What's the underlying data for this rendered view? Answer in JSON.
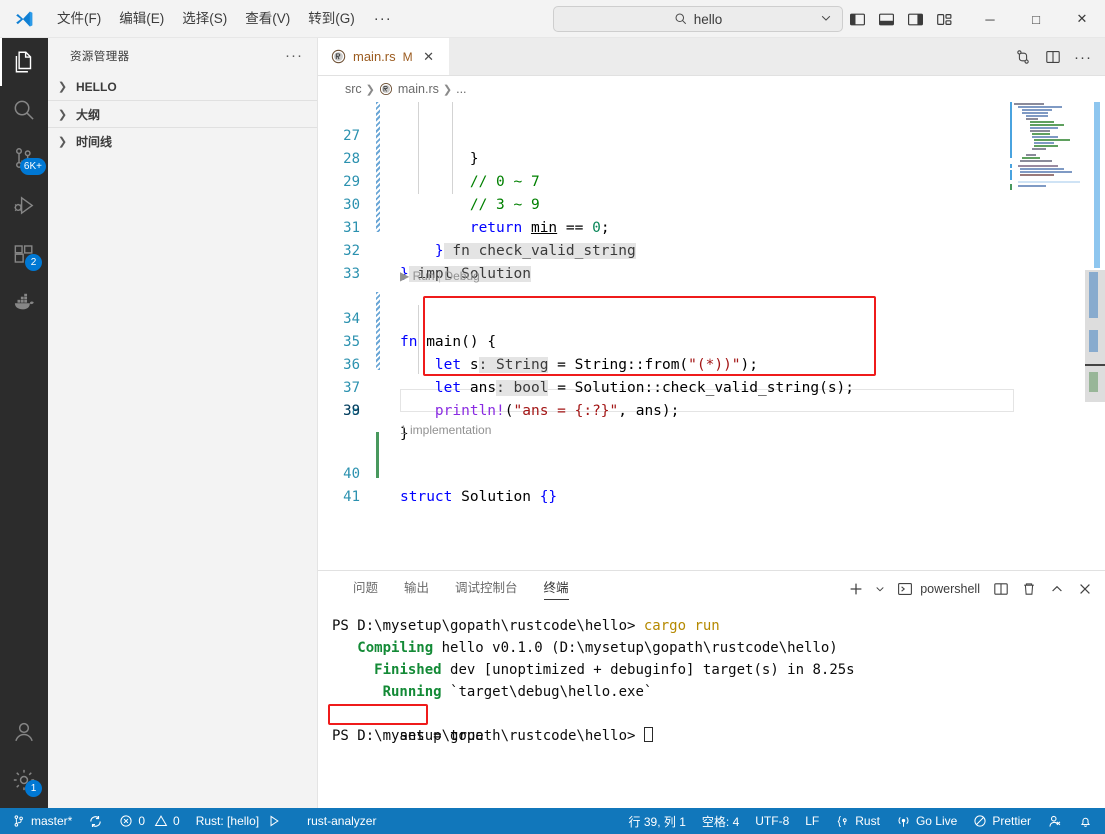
{
  "titlebar": {
    "logo_icon": "vscode-logo-icon",
    "menu": [
      {
        "label": "文件(F)",
        "name": "menu-file"
      },
      {
        "label": "编辑(E)",
        "name": "menu-edit"
      },
      {
        "label": "选择(S)",
        "name": "menu-selection"
      },
      {
        "label": "查看(V)",
        "name": "menu-view"
      },
      {
        "label": "转到(G)",
        "name": "menu-go"
      }
    ],
    "more_label": "···",
    "quick_open": {
      "value": "hello",
      "search_icon": "search-icon",
      "chevron_icon": "chevron-down-icon"
    },
    "layout_icons": [
      {
        "name": "toggle-primary-sidebar-icon"
      },
      {
        "name": "toggle-panel-icon"
      },
      {
        "name": "toggle-secondary-sidebar-icon"
      },
      {
        "name": "customize-layout-icon"
      }
    ],
    "window_controls": {
      "minimize": "─",
      "maximize": "□",
      "close": "✕"
    }
  },
  "activitybar": {
    "items": [
      {
        "name": "activity-explorer",
        "icon": "files-icon",
        "badge": "",
        "active": true
      },
      {
        "name": "activity-search",
        "icon": "search-icon",
        "badge": "",
        "active": false
      },
      {
        "name": "activity-source-control",
        "icon": "source-control-icon",
        "badge": "6K+",
        "active": false
      },
      {
        "name": "activity-run-debug",
        "icon": "run-debug-icon",
        "badge": "",
        "active": false
      },
      {
        "name": "activity-extensions",
        "icon": "extensions-icon",
        "badge": "2",
        "active": false
      },
      {
        "name": "activity-docker",
        "icon": "docker-icon",
        "badge": "",
        "active": false
      }
    ],
    "bottom": [
      {
        "name": "activity-accounts",
        "icon": "account-icon",
        "badge": ""
      },
      {
        "name": "activity-settings",
        "icon": "gear-icon",
        "badge": "1"
      }
    ]
  },
  "sidebar": {
    "title": "资源管理器",
    "more_label": "···",
    "sections": [
      {
        "label": "HELLO",
        "name": "sidebar-section-hello",
        "expanded": false
      },
      {
        "label": "大纲",
        "name": "sidebar-section-outline",
        "expanded": false
      },
      {
        "label": "时间线",
        "name": "sidebar-section-timeline",
        "expanded": false
      }
    ]
  },
  "editor": {
    "tab": {
      "label": "main.rs",
      "modified_indicator": "M",
      "close_icon": "close-icon",
      "file_icon": "rust-icon"
    },
    "tab_actions": [
      {
        "name": "split-compare-icon"
      },
      {
        "name": "split-editor-icon"
      },
      {
        "name": "editor-more-actions-icon"
      }
    ],
    "breadcrumb": [
      "src",
      "main.rs",
      "..."
    ],
    "codelens_run": "Run",
    "codelens_debug": "Debug",
    "codelens_impl": "1 implementation",
    "lines": [
      {
        "num": "27",
        "text": "        }"
      },
      {
        "num": "28",
        "text": "        // 0 ~ 7"
      },
      {
        "num": "29",
        "text": "        // 3 ~ 9"
      },
      {
        "num": "30",
        "text": "        return min == 0;"
      },
      {
        "num": "31",
        "text": "    } fn check_valid_string"
      },
      {
        "num": "32",
        "text": "} impl Solution"
      },
      {
        "num": "33",
        "text": ""
      },
      {
        "num": "34",
        "text": "fn main() {"
      },
      {
        "num": "35",
        "text": "    let s: String = String::from(\"(*))\");"
      },
      {
        "num": "36",
        "text": "    let ans: bool = Solution::check_valid_string(s);"
      },
      {
        "num": "37",
        "text": "    println!(\"ans = {:?}\", ans);"
      },
      {
        "num": "38",
        "text": "}"
      },
      {
        "num": "39",
        "text": ""
      },
      {
        "num": "40",
        "text": "struct Solution {}"
      },
      {
        "num": "41",
        "text": ""
      }
    ]
  },
  "panel": {
    "tabs": [
      {
        "label": "问题",
        "name": "panel-tab-problems",
        "active": false
      },
      {
        "label": "输出",
        "name": "panel-tab-output",
        "active": false
      },
      {
        "label": "调试控制台",
        "name": "panel-tab-debug-console",
        "active": false
      },
      {
        "label": "终端",
        "name": "panel-tab-terminal",
        "active": true
      }
    ],
    "actions": {
      "new_terminal_icon": "plus-icon",
      "new_terminal_dropdown_icon": "chevron-down-icon",
      "shell_icon": "terminal-icon",
      "shell_name": "powershell",
      "split_icon": "split-terminal-icon",
      "kill_icon": "trash-icon",
      "maximize_icon": "chevron-up-icon",
      "close_icon": "close-icon"
    },
    "terminal_lines": [
      {
        "prompt": "PS D:\\mysetup\\gopath\\rustcode\\hello>",
        "cmd": " cargo run"
      },
      {
        "label": "Compiling",
        "rest": " hello v0.1.0 (D:\\mysetup\\gopath\\rustcode\\hello)"
      },
      {
        "label": "Finished",
        "rest": " dev [unoptimized + debuginfo] target(s) in 8.25s"
      },
      {
        "label": "Running",
        "rest": " `target\\debug\\hello.exe`"
      },
      {
        "output": "ans = true"
      },
      {
        "prompt": "PS D:\\mysetup\\gopath\\rustcode\\hello>",
        "cmd": " "
      }
    ]
  },
  "statusbar": {
    "branch": "master*",
    "branch_icon": "source-control-icon",
    "sync_icon": "sync-icon",
    "errors": "0",
    "warnings": "0",
    "error_icon": "error-icon",
    "warning_icon": "warning-icon",
    "rust_project": "Rust: [hello]",
    "run_icon": "run-icon",
    "analyzer": "rust-analyzer",
    "position": "行 39, 列 1",
    "indent": "空格: 4",
    "encoding": "UTF-8",
    "eol": "LF",
    "language": "Rust",
    "language_icon": "rust-brace-icon",
    "golive": "Go Live",
    "golive_icon": "broadcast-icon",
    "prettier": "Prettier",
    "prettier_icon": "prettier-icon",
    "remote_icon": "remote-icon",
    "bell_icon": "bell-icon"
  },
  "colors": {
    "accent": "#1177bb",
    "badge": "#0078d4",
    "annotation_red": "#ef1b1b",
    "titlebar_bg": "#f3f3f3",
    "activitybar_bg": "#2c2c2c",
    "sidebar_bg": "#f3f3f3"
  }
}
